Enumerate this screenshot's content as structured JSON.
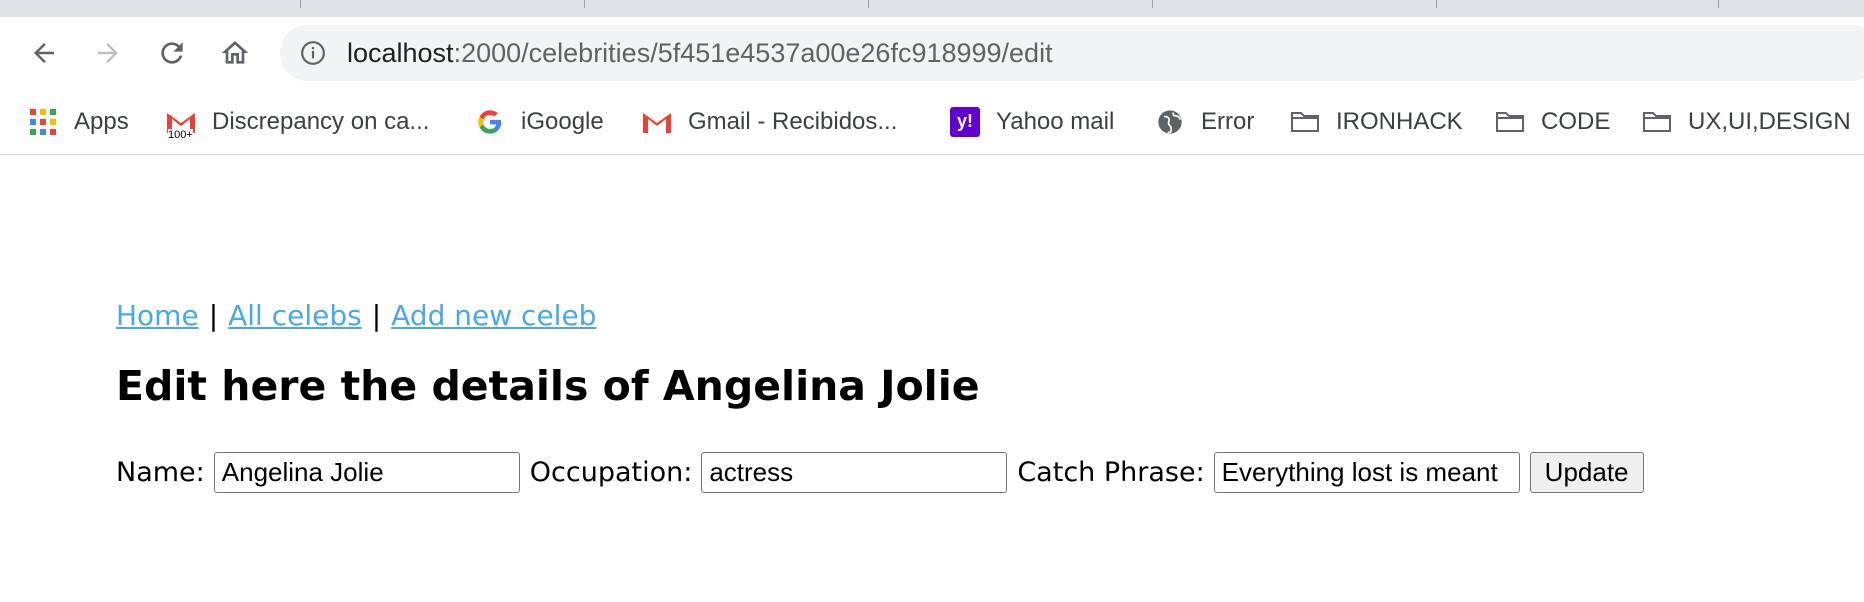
{
  "browser": {
    "url_host": "localhost",
    "url_rest": ":2000/celebrities/5f451e4537a00e26fc918999/edit",
    "bookmarks": [
      {
        "label": "Apps",
        "icon": "apps-grid-icon"
      },
      {
        "label": "Discrepancy on ca...",
        "icon": "gmail-icon",
        "badge": "100+"
      },
      {
        "label": "iGoogle",
        "icon": "google-icon"
      },
      {
        "label": "Gmail - Recibidos...",
        "icon": "gmail-icon"
      },
      {
        "label": "Yahoo mail",
        "icon": "yahoo-icon"
      },
      {
        "label": "Error",
        "icon": "globe-icon"
      },
      {
        "label": "IRONHACK",
        "icon": "folder-icon"
      },
      {
        "label": "CODE",
        "icon": "folder-icon"
      },
      {
        "label": "UX,UI,DESIGN",
        "icon": "folder-icon"
      }
    ]
  },
  "nav": {
    "home": "Home",
    "sep1": "|",
    "all": "All celebs",
    "sep2": "|",
    "add": "Add new celeb"
  },
  "page": {
    "title": "Edit here the details of Angelina Jolie"
  },
  "form": {
    "name_label": "Name:",
    "name_value": "Angelina Jolie",
    "occupation_label": "Occupation:",
    "occupation_value": "actress",
    "catch_label": "Catch Phrase:",
    "catch_value": "Everything lost is meant",
    "submit": "Update"
  },
  "colors": {
    "link": "#4aa8e8",
    "chrome_bg": "#dee1e6",
    "omnibox_bg": "#f1f3f4"
  }
}
